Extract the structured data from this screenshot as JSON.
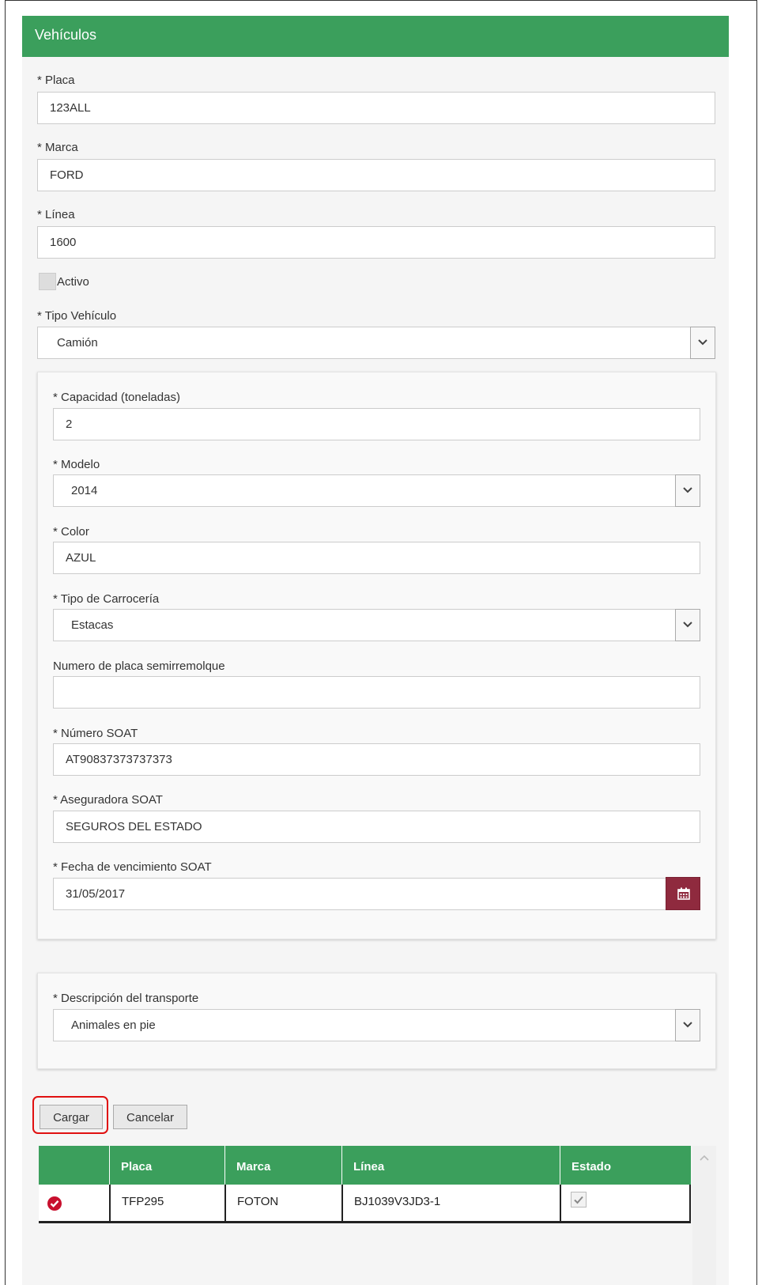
{
  "panel": {
    "title": "Vehículos"
  },
  "form": {
    "placa": {
      "label": "* Placa",
      "value": "123ALL"
    },
    "marca": {
      "label": "* Marca",
      "value": "FORD"
    },
    "linea": {
      "label": "* Línea",
      "value": "1600"
    },
    "activo": {
      "label": "Activo",
      "checked": false
    },
    "tipo_vehiculo": {
      "label": "* Tipo Vehículo",
      "value": "Camión"
    }
  },
  "detalle": {
    "capacidad": {
      "label": "* Capacidad (toneladas)",
      "value": "2"
    },
    "modelo": {
      "label": "* Modelo",
      "value": "2014"
    },
    "color": {
      "label": "* Color",
      "value": "AZUL"
    },
    "carroceria": {
      "label": "* Tipo de Carrocería",
      "value": "Estacas"
    },
    "semirremolque": {
      "label": "Numero de placa semirremolque",
      "value": ""
    },
    "numero_soat": {
      "label": "* Número SOAT",
      "value": "AT90837373737373"
    },
    "aseguradora_soat": {
      "label": "* Aseguradora SOAT",
      "value": "SEGUROS DEL ESTADO"
    },
    "fecha_soat": {
      "label": "* Fecha de vencimiento SOAT",
      "value": "31/05/2017"
    }
  },
  "transporte": {
    "label": "* Descripción del transporte",
    "value": "Animales en pie"
  },
  "buttons": {
    "cargar": "Cargar",
    "cancelar": "Cancelar"
  },
  "table": {
    "headers": [
      "",
      "Placa",
      "Marca",
      "Línea",
      "Estado"
    ],
    "rows": [
      {
        "placa": "TFP295",
        "marca": "FOTON",
        "linea": "BJ1039V3JD3-1",
        "estado": true
      }
    ]
  },
  "colors": {
    "header_green": "#3b9f5c",
    "calendar_button": "#8f2a3e",
    "status_icon": "#c8102e",
    "highlight_border": "#e01010"
  }
}
